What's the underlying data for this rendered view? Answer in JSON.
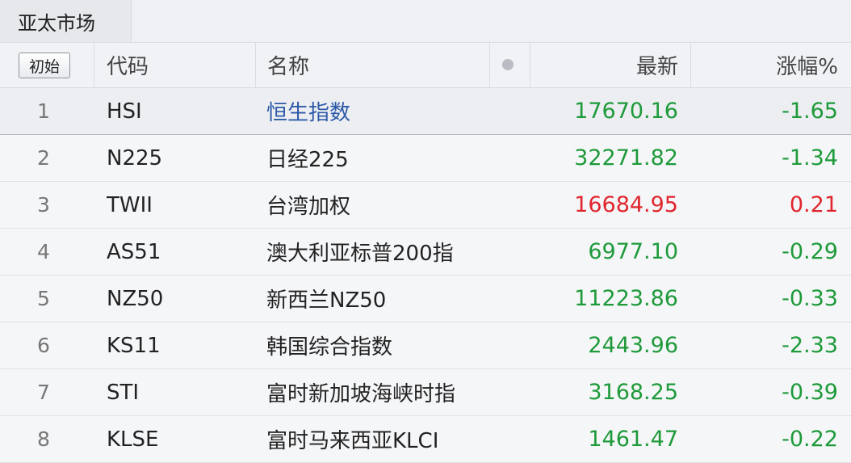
{
  "tab": {
    "label": "亚太市场"
  },
  "header": {
    "init_button": "初始",
    "code": "代码",
    "name": "名称",
    "last": "最新",
    "change_pct": "涨幅%"
  },
  "colors": {
    "down": "#1e9a3a",
    "up": "#e0262e",
    "link": "#2d5aa8"
  },
  "rows": [
    {
      "index": "1",
      "code": "HSI",
      "name": "恒生指数",
      "last": "17670.16",
      "change": "-1.65",
      "direction": "down",
      "selected": true
    },
    {
      "index": "2",
      "code": "N225",
      "name": "日经225",
      "last": "32271.82",
      "change": "-1.34",
      "direction": "down"
    },
    {
      "index": "3",
      "code": "TWII",
      "name": "台湾加权",
      "last": "16684.95",
      "change": "0.21",
      "direction": "up"
    },
    {
      "index": "4",
      "code": "AS51",
      "name": "澳大利亚标普200指",
      "last": "6977.10",
      "change": "-0.29",
      "direction": "down"
    },
    {
      "index": "5",
      "code": "NZ50",
      "name": "新西兰NZ50",
      "last": "11223.86",
      "change": "-0.33",
      "direction": "down"
    },
    {
      "index": "6",
      "code": "KS11",
      "name": "韩国综合指数",
      "last": "2443.96",
      "change": "-2.33",
      "direction": "down"
    },
    {
      "index": "7",
      "code": "STI",
      "name": "富时新加坡海峡时指",
      "last": "3168.25",
      "change": "-0.39",
      "direction": "down"
    },
    {
      "index": "8",
      "code": "KLSE",
      "name": "富时马来西亚KLCI",
      "last": "1461.47",
      "change": "-0.22",
      "direction": "down"
    }
  ]
}
